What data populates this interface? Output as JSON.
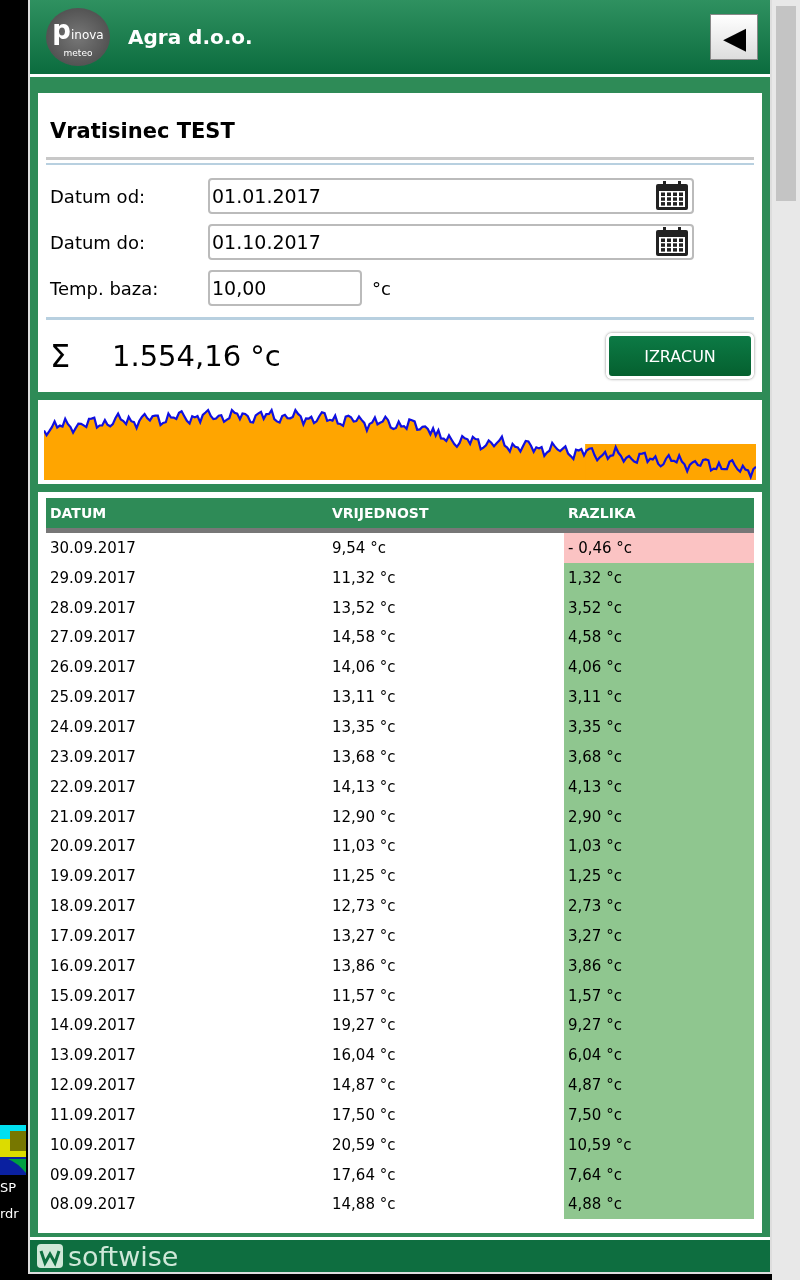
{
  "desktop": {
    "icon_labels": [
      "SP",
      "rdr"
    ]
  },
  "header": {
    "logo_big": "p",
    "logo_top": "inova",
    "logo_bottom": "meteo",
    "title": "Agra d.o.o.",
    "back_button": "◀"
  },
  "form": {
    "title": "Vratisinec TEST",
    "fields": [
      {
        "label": "Datum od:",
        "value": "01.01.2017",
        "kind": "date"
      },
      {
        "label": "Datum do:",
        "value": "01.10.2017",
        "kind": "date"
      },
      {
        "label": "Temp. baza:",
        "value": "10,00",
        "kind": "number",
        "unit": "°c"
      }
    ],
    "sum_symbol": "Σ",
    "sum_value": "1.554,16 °c",
    "calculate_button": "IZRACUN"
  },
  "table": {
    "columns": [
      "DATUM",
      "VRIJEDNOST",
      "RAZLIKA"
    ],
    "rows": [
      {
        "date": "30.09.2017",
        "value": "9,54 °c",
        "difference": "- 0,46 °c",
        "kind": "below"
      },
      {
        "date": "29.09.2017",
        "value": "11,32 °c",
        "difference": "1,32 °c",
        "kind": "above"
      },
      {
        "date": "28.09.2017",
        "value": "13,52 °c",
        "difference": "3,52 °c",
        "kind": "above"
      },
      {
        "date": "27.09.2017",
        "value": "14,58 °c",
        "difference": "4,58 °c",
        "kind": "above"
      },
      {
        "date": "26.09.2017",
        "value": "14,06 °c",
        "difference": "4,06 °c",
        "kind": "above"
      },
      {
        "date": "25.09.2017",
        "value": "13,11 °c",
        "difference": "3,11 °c",
        "kind": "above"
      },
      {
        "date": "24.09.2017",
        "value": "13,35 °c",
        "difference": "3,35 °c",
        "kind": "above"
      },
      {
        "date": "23.09.2017",
        "value": "13,68 °c",
        "difference": "3,68 °c",
        "kind": "above"
      },
      {
        "date": "22.09.2017",
        "value": "14,13 °c",
        "difference": "4,13 °c",
        "kind": "above"
      },
      {
        "date": "21.09.2017",
        "value": "12,90 °c",
        "difference": "2,90 °c",
        "kind": "above"
      },
      {
        "date": "20.09.2017",
        "value": "11,03 °c",
        "difference": "1,03 °c",
        "kind": "above"
      },
      {
        "date": "19.09.2017",
        "value": "11,25 °c",
        "difference": "1,25 °c",
        "kind": "above"
      },
      {
        "date": "18.09.2017",
        "value": "12,73 °c",
        "difference": "2,73 °c",
        "kind": "above"
      },
      {
        "date": "17.09.2017",
        "value": "13,27 °c",
        "difference": "3,27 °c",
        "kind": "above"
      },
      {
        "date": "16.09.2017",
        "value": "13,86 °c",
        "difference": "3,86 °c",
        "kind": "above"
      },
      {
        "date": "15.09.2017",
        "value": "11,57 °c",
        "difference": "1,57 °c",
        "kind": "above"
      },
      {
        "date": "14.09.2017",
        "value": "19,27 °c",
        "difference": "9,27 °c",
        "kind": "above"
      },
      {
        "date": "13.09.2017",
        "value": "16,04 °c",
        "difference": "6,04 °c",
        "kind": "above"
      },
      {
        "date": "12.09.2017",
        "value": "14,87 °c",
        "difference": "4,87 °c",
        "kind": "above"
      },
      {
        "date": "11.09.2017",
        "value": "17,50 °c",
        "difference": "7,50 °c",
        "kind": "above"
      },
      {
        "date": "10.09.2017",
        "value": "20,59 °c",
        "difference": "10,59 °c",
        "kind": "above"
      },
      {
        "date": "09.09.2017",
        "value": "17,64 °c",
        "difference": "7,64 °c",
        "kind": "above"
      },
      {
        "date": "08.09.2017",
        "value": "14,88 °c",
        "difference": "4,88 °c",
        "kind": "above"
      }
    ]
  },
  "footer": {
    "brand": "softwise"
  }
}
